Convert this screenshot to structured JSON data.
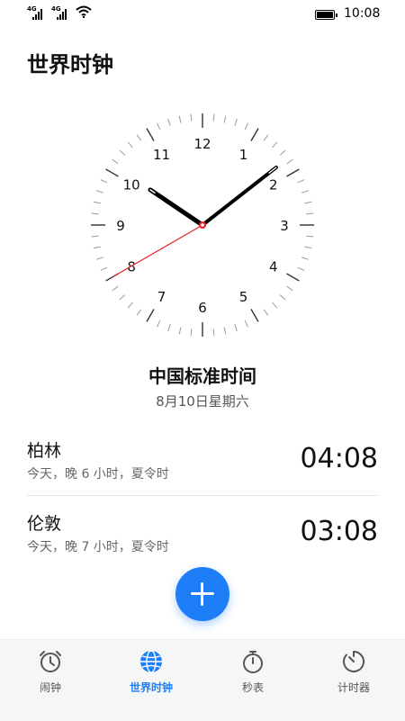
{
  "status_bar": {
    "network_1": "4G",
    "network_2": "4G",
    "time": "10:08"
  },
  "header": {
    "title": "世界时钟"
  },
  "clock": {
    "numbers": [
      "12",
      "1",
      "2",
      "3",
      "4",
      "5",
      "6",
      "7",
      "8",
      "9",
      "10",
      "11"
    ],
    "hour": 10,
    "minute": 8,
    "second": 40,
    "timezone_name": "中国标准时间",
    "date": "8月10日星期六",
    "second_hand_color": "#e8252c"
  },
  "cities": [
    {
      "name": "柏林",
      "desc": "今天，晚 6 小时，夏令时",
      "time": "04:08"
    },
    {
      "name": "伦敦",
      "desc": "今天，晚 7 小时，夏令时",
      "time": "03:08"
    }
  ],
  "fab": {
    "icon": "plus-icon",
    "color": "#1e7ef7"
  },
  "bottom_nav": {
    "active_color": "#1e7ef7",
    "items": [
      {
        "label": "闹钟",
        "icon": "alarm-clock-icon",
        "active": false
      },
      {
        "label": "世界时钟",
        "icon": "globe-icon",
        "active": true
      },
      {
        "label": "秒表",
        "icon": "stopwatch-icon",
        "active": false
      },
      {
        "label": "计时器",
        "icon": "timer-icon",
        "active": false
      }
    ]
  }
}
